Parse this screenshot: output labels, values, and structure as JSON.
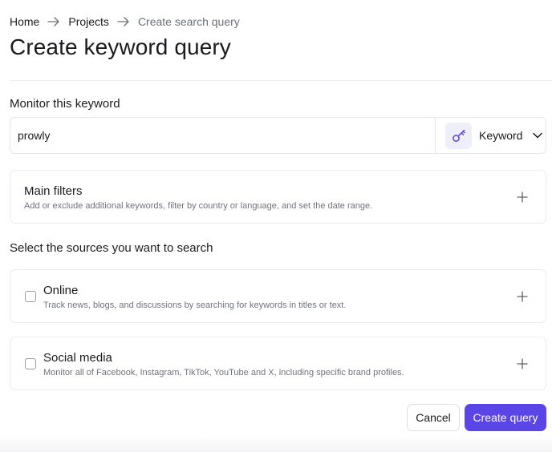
{
  "breadcrumb": {
    "items": [
      "Home",
      "Projects"
    ],
    "current": "Create search query"
  },
  "page": {
    "title": "Create keyword query"
  },
  "keyword": {
    "label": "Monitor this keyword",
    "value": "prowly",
    "type": "Keyword",
    "type_icon": "key-icon"
  },
  "main_filters": {
    "title": "Main filters",
    "description": "Add or exclude additional keywords, filter by country or language, and set the date range."
  },
  "sources": {
    "label": "Select the sources you want to search",
    "items": [
      {
        "title": "Online",
        "description": "Track news, blogs, and discussions by searching for keywords in titles or text.",
        "checked": false
      },
      {
        "title": "Social media",
        "description": "Monitor all of Facebook, Instagram, TikTok, YouTube and X, including specific brand profiles.",
        "checked": false
      }
    ]
  },
  "actions": {
    "cancel": "Cancel",
    "create": "Create query"
  },
  "colors": {
    "accent": "#5a45e6",
    "key_icon_bg": "#efeefb"
  }
}
